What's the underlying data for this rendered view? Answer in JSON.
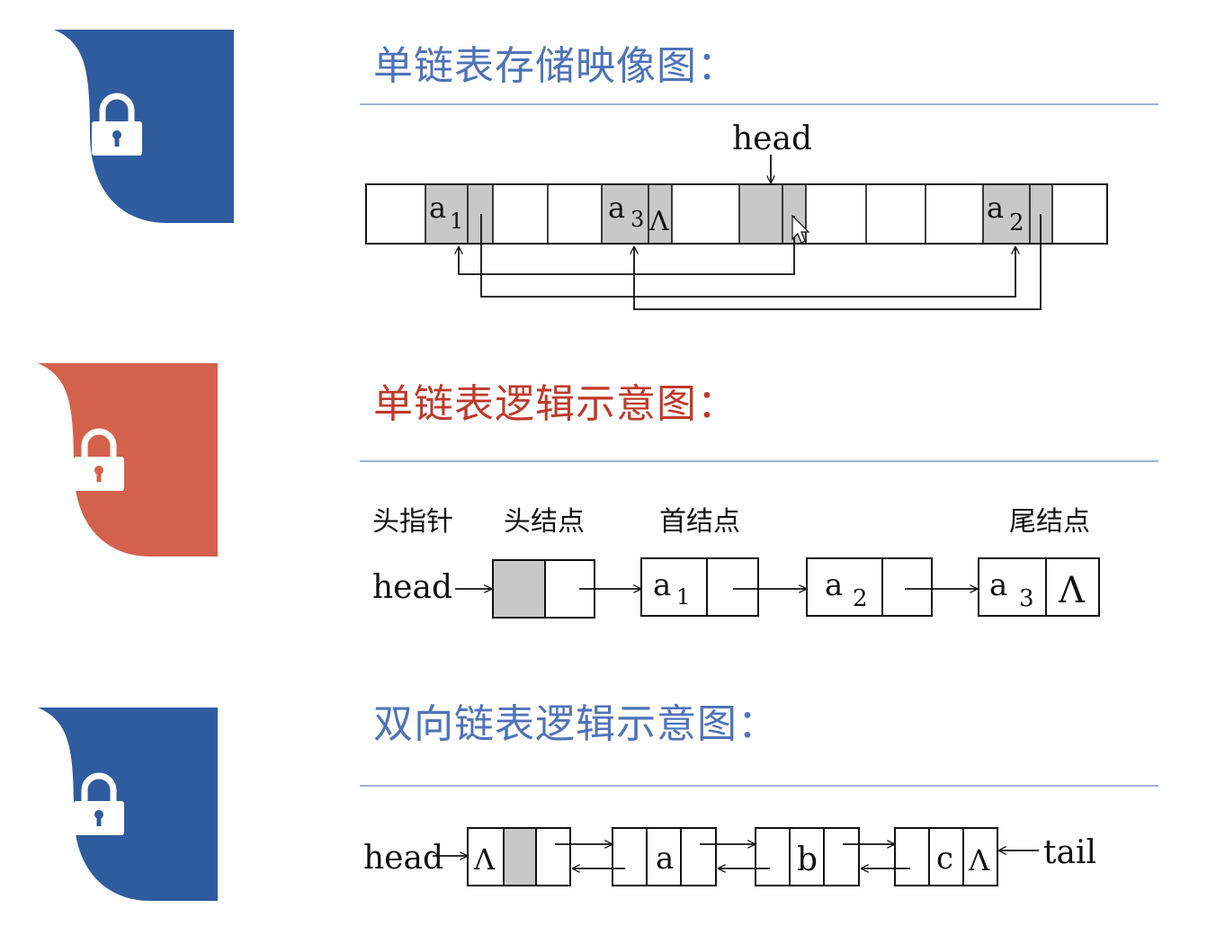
{
  "colors": {
    "blue": "#2f5b9f",
    "red": "#d4614c",
    "title_blue": "#4f73b8",
    "title_red": "#c0392b",
    "rule": "#9db3cf",
    "shade": "#c8c8c8"
  },
  "icons": [
    "lock-icon",
    "lock-icon",
    "lock-icon"
  ],
  "sections": {
    "storage": {
      "title": "单链表存储映像图：",
      "head_label": "head",
      "cells": {
        "a1": "a",
        "a1_sub": "1",
        "a3": "a",
        "a3_sub": "3",
        "a3_null": "Λ",
        "a2": "a",
        "a2_sub": "2"
      }
    },
    "logical": {
      "title": "单链表逻辑示意图：",
      "labels": {
        "head_pointer": "头指针",
        "head_node": "头结点",
        "first_node": "首结点",
        "tail_node": "尾结点"
      },
      "head_text": "head",
      "nodes": [
        {
          "letter": "a",
          "sub": "1"
        },
        {
          "letter": "a",
          "sub": "2"
        },
        {
          "letter": "a",
          "sub": "3"
        }
      ],
      "null_symbol": "Λ"
    },
    "doubly": {
      "title": "双向链表逻辑示意图：",
      "head_text": "head",
      "tail_text": "tail",
      "nodes": [
        "a",
        "b",
        "c"
      ],
      "null_symbol": "Λ"
    }
  }
}
